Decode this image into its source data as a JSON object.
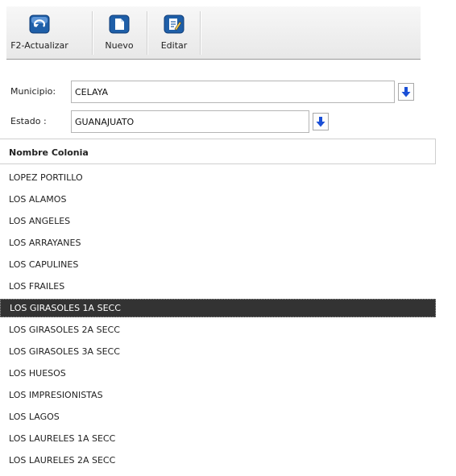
{
  "toolbar": {
    "buttons": [
      {
        "label": "F2-Actualizar",
        "icon": "refresh-icon"
      },
      {
        "label": "Nuevo",
        "icon": "new-document-icon"
      },
      {
        "label": "Editar",
        "icon": "edit-icon"
      }
    ]
  },
  "form": {
    "municipio_label": "Municipio:",
    "municipio_value": "CELAYA",
    "estado_label": "Estado :",
    "estado_value": "GUANAJUATO"
  },
  "grid": {
    "column_header": "Nombre Colonia",
    "rows": [
      "LOPEZ PORTILLO",
      "LOS ALAMOS",
      "LOS ANGELES",
      "LOS ARRAYANES",
      "LOS CAPULINES",
      "LOS FRAILES",
      "LOS GIRASOLES 1A SECC",
      "LOS GIRASOLES 2A SECC",
      "LOS GIRASOLES 3A SECC",
      "LOS HUESOS",
      "LOS IMPRESIONISTAS",
      "LOS LAGOS",
      "LOS LAURELES 1A SECC",
      "LOS LAURELES 2A SECC"
    ],
    "selected_row": "LOS GIRASOLES 1A SECC"
  },
  "colors": {
    "icon_blue": "#1f5fa8",
    "dropdown_arrow": "#1a4fd6",
    "selected_bg": "#333333",
    "selected_text": "#ffffff"
  }
}
